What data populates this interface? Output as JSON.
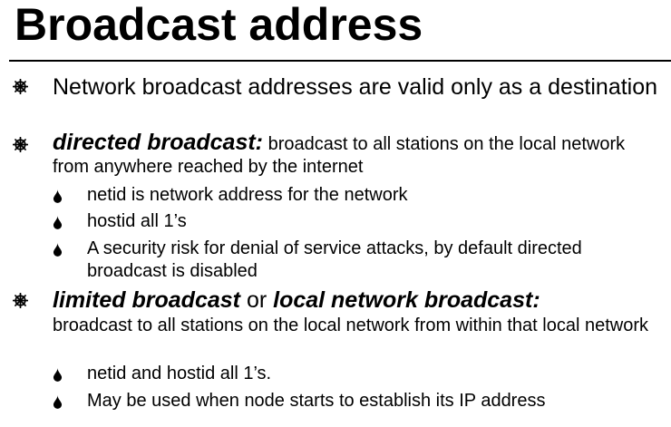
{
  "title": "Broadcast address",
  "items": [
    {
      "text": "Network broadcast addresses are valid only as a destination"
    },
    {
      "heading": "directed broadcast:",
      "text": " broadcast to all stations on the local network from anywhere reached by the internet",
      "subitems": [
        "netid is network address for the network",
        "hostid all 1’s",
        "A security risk for denial of service attacks, by default directed broadcast is disabled"
      ]
    },
    {
      "heading": "limited broadcast",
      "connector": " or ",
      "heading2": "local network broadcast:",
      "text": "broadcast to all stations on the local network from within that local network",
      "subitems": [
        "netid and hostid all 1’s.",
        "May be used when node starts to establish its IP address"
      ]
    }
  ],
  "icons": {
    "level1_bullet": "wheel-bullet-icon",
    "level2_bullet": "drop-bullet-icon"
  }
}
